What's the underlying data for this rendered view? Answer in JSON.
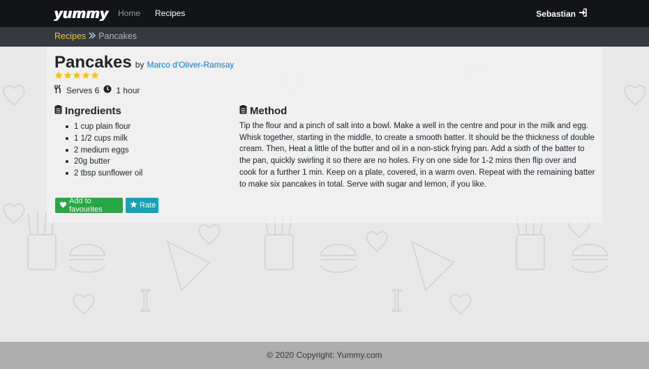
{
  "nav": {
    "brand": "yummy",
    "links": [
      {
        "label": "Home"
      },
      {
        "label": "Recipes"
      }
    ],
    "user": "Sebastian"
  },
  "breadcrumb": {
    "parent": "Recipes",
    "current": "Pancakes"
  },
  "recipe": {
    "title": "Pancakes",
    "by": "by",
    "author": "Marco d'Oliver-Ramsay",
    "rating": 5,
    "serves": "Serves 6",
    "time": "1 hour",
    "ingredients_heading": "Ingredients",
    "ingredients": [
      "1 cup plain flour",
      "1 1/2 cups milk",
      "2 medium eggs",
      "20g butter",
      "2 tbsp sunflower oil"
    ],
    "method_heading": "Method",
    "method": "Tip the flour and a pinch of salt into a bowl. Make a well in the centre and pour in the milk and egg. Whisk together, starting in the middle, to create a smooth batter. It should be the thickness of double cream. Then, Heat a little of the butter and oil in a non-stick frying pan. Add a sixth of the batter to the pan, quickly swirling it so there are no holes. Fry on one side for 1-2 mins then flip over and cook for a further 1 min. Keep on a plate, covered, in a warm oven. Repeat with the remaining batter to make six pancakes in total. Serve with sugar and lemon, if you like."
  },
  "actions": {
    "favourite": "Add to favourites",
    "rate": "Rate"
  },
  "footer": {
    "text": "© 2020 Copyright: Yummy.com"
  },
  "colors": {
    "navbar": "#121417",
    "breadcrumb_bar": "#343a40",
    "crumb_link": "#ffc107",
    "author_link": "#007bff",
    "star": "#ffc107",
    "fav_button": "#28a745",
    "rate_button": "#17a2b8",
    "footer": "#adadad"
  },
  "icons": {
    "login": "sign-in-icon",
    "crumb_separator": "double-chevron-right-icon",
    "serves": "utensils-icon",
    "time": "clock-icon",
    "ingredients": "list-icon",
    "method": "list-icon",
    "favourite": "heart-icon",
    "rate": "star-icon"
  }
}
